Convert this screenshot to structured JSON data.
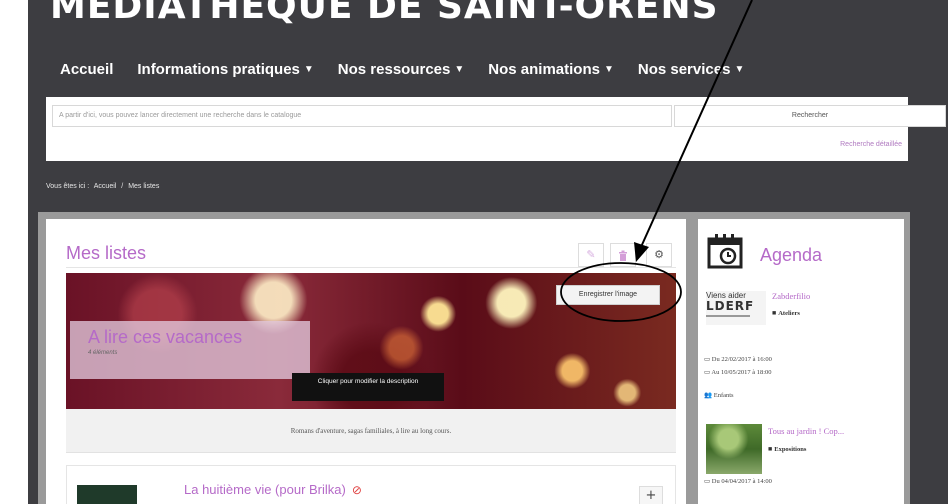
{
  "header": {
    "site_title": "MÉDIATHÈQUE DE SAINT-ORENS"
  },
  "nav": {
    "items": [
      {
        "label": "Accueil",
        "has_menu": false
      },
      {
        "label": "Informations pratiques",
        "has_menu": true
      },
      {
        "label": "Nos ressources",
        "has_menu": true
      },
      {
        "label": "Nos animations",
        "has_menu": true
      },
      {
        "label": "Nos services",
        "has_menu": true
      }
    ],
    "caret": "▼"
  },
  "search": {
    "placeholder": "A partir d'ici, vous pouvez lancer directement une recherche dans le catalogue",
    "button_label": "Rechercher",
    "advanced_link": "Recherche détaillée"
  },
  "breadcrumb": {
    "prefix": "Vous êtes ici :",
    "home": "Accueil",
    "separator": "/",
    "current": "Mes listes"
  },
  "main": {
    "title": "Mes listes",
    "toolbar": {
      "edit_icon": "pencil-icon",
      "delete_icon": "trash-icon",
      "settings_icon": "gear-icon"
    },
    "list": {
      "name": "A lire ces vacances",
      "count_label": "4 éléments",
      "save_image_button": "Enregistrer l'image",
      "edit_description_tip": "Cliquer pour modifier la description",
      "description": "Romans d'aventure, sagas familiales, à lire au long cours."
    },
    "items": [
      {
        "title": "La huitième vie (pour Brilka)",
        "status_icon": "no-entry-icon",
        "add_label": "+"
      }
    ]
  },
  "agenda": {
    "title": "Agenda",
    "events": [
      {
        "thumb_line1": "Viens aider",
        "thumb_line2": "LDERF",
        "title": "Zabderfilio",
        "category": "Ateliers",
        "date_from": "Du 22/02/2017 à 16:00",
        "date_to": "Au 10/05/2017 à 18:00",
        "audience": "Enfants"
      },
      {
        "title": "Tous au jardin ! Cop...",
        "category": "Expositions",
        "date_from": "Du 04/04/2017 à 14:00"
      }
    ]
  },
  "colors": {
    "accent": "#b56ac8",
    "dark_bg": "#3d3d41",
    "annotation": "#000000"
  }
}
